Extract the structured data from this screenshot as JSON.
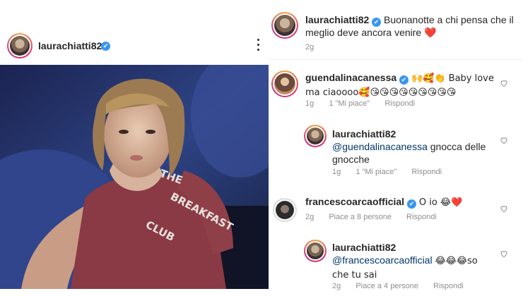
{
  "post": {
    "author": "laurachiatti82",
    "verified_badge": "✔"
  },
  "caption": {
    "author": "laurachiatti82",
    "text": "Buonanotte a chi pensa che il meglio deve ancora venire ❤️",
    "time": "2g"
  },
  "comments": [
    {
      "author": "guendalinacanessa",
      "text": "🙌🥰👏 Baby love ma ciaoooo🥰😘😘😘😘😘😘😘😘😘",
      "time": "1g",
      "likes": "1 \"Mi piace\"",
      "reply_label": "Rispondi"
    },
    {
      "author": "laurachiatti82",
      "mention": "@guendalinacanessa",
      "text": "gnocca delle gnocche",
      "time": "1g",
      "likes": "1 \"Mi piace\"",
      "reply_label": "Rispondi"
    },
    {
      "author": "francescoarcaofficial",
      "text": "O io 😂❤️",
      "time": "2g",
      "likes": "Piace a 8 persone",
      "reply_label": "Rispondi"
    },
    {
      "author": "laurachiatti82",
      "mention": "@francescoarcaofficial",
      "text": "😂😂😂so che tu sai",
      "time": "2g",
      "likes": "Piace a 4 persone",
      "reply_label": "Rispondi"
    }
  ],
  "photo_shirt_text": [
    "THE",
    "BREAKFAST",
    "CLUB"
  ],
  "colors": {
    "verified": "#3897f0",
    "mention": "#00376b",
    "meta": "#8e8e8e"
  }
}
